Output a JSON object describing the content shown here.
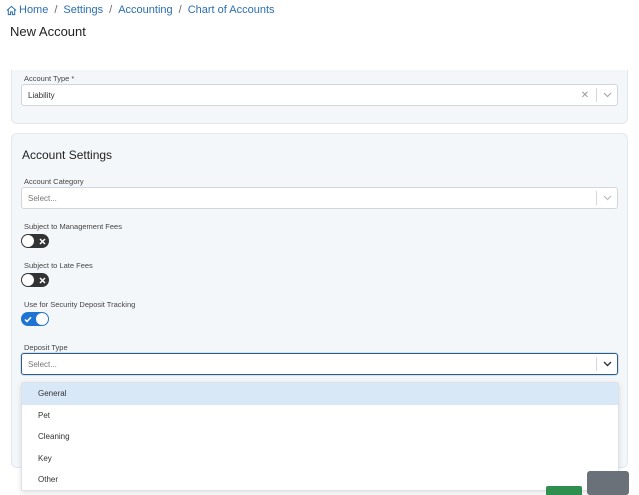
{
  "breadcrumb": {
    "items": [
      "Home",
      "Settings",
      "Accounting",
      "Chart of Accounts"
    ],
    "separator": "/"
  },
  "page": {
    "title": "New Account"
  },
  "account_type": {
    "label": "Account Type",
    "required_marker": "*",
    "value": "Liability"
  },
  "account_settings": {
    "title": "Account Settings",
    "category": {
      "label": "Account Category",
      "placeholder": "Select..."
    },
    "management_fees": {
      "label": "Subject to Management Fees",
      "enabled": false
    },
    "late_fees": {
      "label": "Subject to Late Fees",
      "enabled": false
    },
    "security_deposit": {
      "label": "Use for Security Deposit Tracking",
      "enabled": true
    },
    "deposit_type": {
      "label": "Deposit Type",
      "placeholder": "Select...",
      "options": [
        "General",
        "Pet",
        "Cleaning",
        "Key",
        "Other"
      ],
      "highlighted": "General"
    }
  },
  "colors": {
    "link": "#2a6fb0",
    "toggle_on": "#1f74d2",
    "toggle_off": "#333333",
    "option_highlight": "#d9e8f7",
    "save_button": "#2f8f4e",
    "cancel_button": "#6b7178"
  }
}
